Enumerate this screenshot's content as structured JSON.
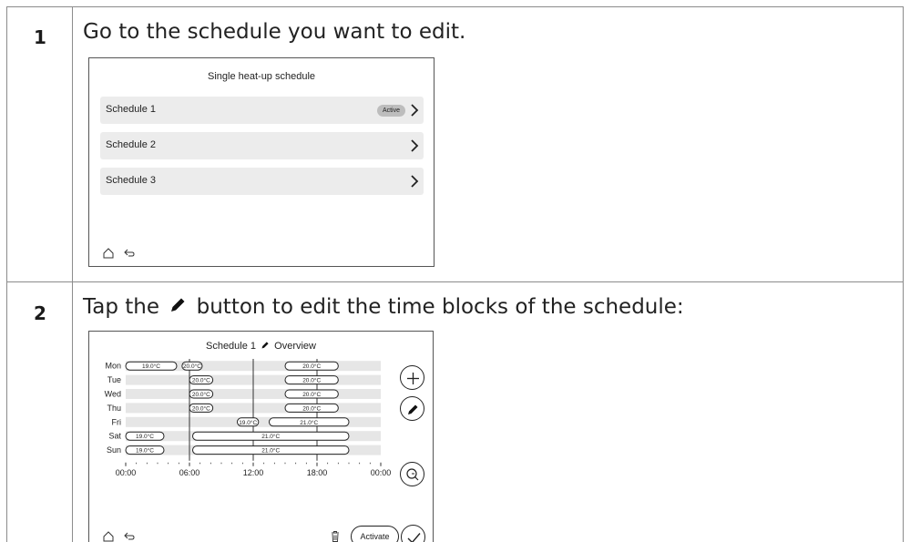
{
  "steps": [
    {
      "number": "1",
      "text": "Go to the schedule you want to edit."
    },
    {
      "number": "2",
      "text_before": "Tap the",
      "text_after": "button to edit the time blocks of the schedule:"
    }
  ],
  "screen1": {
    "title": "Single heat-up schedule",
    "items": [
      {
        "label": "Schedule 1",
        "badge": "Active"
      },
      {
        "label": "Schedule 2"
      },
      {
        "label": "Schedule 3"
      }
    ]
  },
  "screen2": {
    "title_name": "Schedule 1",
    "title_view": "Overview",
    "days": [
      "Mon",
      "Tue",
      "Wed",
      "Thu",
      "Fri",
      "Sat",
      "Sun"
    ],
    "blocks": [
      [
        {
          "start": 0,
          "end": 4.8,
          "label": "19.0°C"
        },
        {
          "start": 5.3,
          "end": 7.2,
          "label": "20.0°C"
        },
        {
          "start": 15.0,
          "end": 20.0,
          "label": "20.0°C"
        }
      ],
      [
        {
          "start": 6.0,
          "end": 8.2,
          "label": "20.0°C"
        },
        {
          "start": 15.0,
          "end": 20.0,
          "label": "20.0°C"
        }
      ],
      [
        {
          "start": 6.0,
          "end": 8.2,
          "label": "20.0°C"
        },
        {
          "start": 15.0,
          "end": 20.0,
          "label": "20.0°C"
        }
      ],
      [
        {
          "start": 6.0,
          "end": 8.2,
          "label": "20.0°C"
        },
        {
          "start": 15.0,
          "end": 20.0,
          "label": "20.0°C"
        }
      ],
      [
        {
          "start": 10.5,
          "end": 12.5,
          "label": "19.0°C"
        },
        {
          "start": 13.5,
          "end": 21.0,
          "label": "21.0°C"
        }
      ],
      [
        {
          "start": 0,
          "end": 3.6,
          "label": "19.0°C"
        },
        {
          "start": 6.3,
          "end": 21.0,
          "label": "21.0°C"
        }
      ],
      [
        {
          "start": 0,
          "end": 3.6,
          "label": "19.0°C"
        },
        {
          "start": 6.3,
          "end": 21.0,
          "label": "21.0°C"
        }
      ]
    ],
    "time_labels": [
      "00:00",
      "06:00",
      "12:00",
      "18:00",
      "00:00"
    ],
    "activate_label": "Activate",
    "icons": [
      "plus-icon",
      "pencil-icon",
      "zoom-icon",
      "trash-icon",
      "check-icon",
      "home-icon",
      "back-icon"
    ]
  }
}
